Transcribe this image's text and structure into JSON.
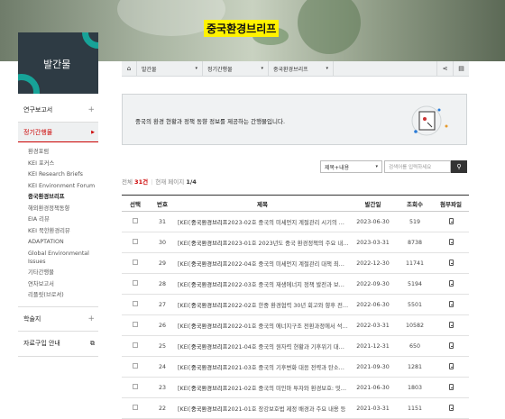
{
  "hero": {
    "title": "중국환경브리프"
  },
  "badge": {
    "label": "발간물"
  },
  "sidebar": {
    "sections": [
      {
        "label": "연구보고서",
        "icon": "plus-icon"
      },
      {
        "label": "정기간행물",
        "icon": "triangle-right-icon",
        "active": true
      },
      {
        "label": "학술지",
        "icon": "plus-icon"
      },
      {
        "label": "자료구입 안내",
        "icon": "external-link-icon"
      }
    ],
    "subitems": [
      "환경포럼",
      "KEI 포커스",
      "KEI Research Briefs",
      "KEI Environment Forum",
      "중국환경브리프",
      "해외환경정책동향",
      "EIA 리뷰",
      "KEI 북한환경리뷰",
      "ADAPTATION",
      "Global Environmental",
      "Issues",
      "기타간행물",
      "연차보고서",
      "리플릿(브로셔)"
    ]
  },
  "navbar": {
    "home": "home-icon",
    "crumb1": "발간물",
    "crumb2": "정기간행물",
    "crumb3": "중국환경브리프",
    "share": "share-icon",
    "print": "print-icon"
  },
  "info": {
    "text": "중국의 환경 현황과 정책 동향 정보를 제공하는 간행물입니다."
  },
  "search": {
    "select": "제목+내용",
    "placeholder": "검색어를 입력하세요",
    "button": "search-icon"
  },
  "count": {
    "total_label": "전체",
    "total": "31건",
    "page_label": "현재 페이지",
    "page": "1/4"
  },
  "table": {
    "headers": [
      "선택",
      "번호",
      "제목",
      "발간일",
      "조회수",
      "첨부파일"
    ],
    "rows": [
      {
        "no": "31",
        "prefix": "[KEI]",
        "hl": "중국환경브리프",
        "rest": "2023-02호 중국의 미세먼지 계절관리 시기의 대기 ...",
        "date": "2023-06-30",
        "views": "519"
      },
      {
        "no": "30",
        "prefix": "[KEI]",
        "hl": "중국환경브리프",
        "rest": "2023-01호 2023년도 중국 환경정책의 주요 내용 ...",
        "date": "2023-03-31",
        "views": "8738"
      },
      {
        "no": "29",
        "prefix": "[KEI]",
        "hl": "중국환경브리프",
        "rest": "2022-04호 중국의 미세먼지 계절관리 대책 최근 동...",
        "date": "2022-12-30",
        "views": "11741"
      },
      {
        "no": "28",
        "prefix": "[KEI]",
        "hl": "중국환경브리프",
        "rest": "2022-03호 중국의 재생에너지 정책 발전과 보급 동...",
        "date": "2022-09-30",
        "views": "5194"
      },
      {
        "no": "27",
        "prefix": "[KEI]",
        "hl": "중국환경브리프",
        "rest": "2022-02호 한중 환경협력 30년 회고와 향후 전망 등",
        "date": "2022-06-30",
        "views": "5501"
      },
      {
        "no": "26",
        "prefix": "[KEI]",
        "hl": "중국환경브리프",
        "rest": "2022-01호 중국의 에너지구조 전환과정에서 석탄 ...",
        "date": "2022-03-31",
        "views": "10582"
      },
      {
        "no": "25",
        "prefix": "[KEI]",
        "hl": "중국환경브리프",
        "rest": "2021-04호 중국의 원자력 현황과 기후위기 대응을 ...",
        "date": "2021-12-31",
        "views": "650"
      },
      {
        "no": "24",
        "prefix": "[KEI]",
        "hl": "중국환경브리프",
        "rest": "2021-03호 중국의 기후변화 대응 전략과 탄소중립 ...",
        "date": "2021-09-30",
        "views": "1281"
      },
      {
        "no": "23",
        "prefix": "[KEI]",
        "hl": "중국환경브리프",
        "rest": "2021-02호 중국의 미인마 투자와 환경보호: 밋손댐 ...",
        "date": "2021-06-30",
        "views": "1803"
      },
      {
        "no": "22",
        "prefix": "[KEI]",
        "hl": "중국환경브리프",
        "rest": "2021-01호 장강보호법 제정 배경과 주요 내용 등",
        "date": "2021-03-31",
        "views": "1151"
      }
    ]
  }
}
